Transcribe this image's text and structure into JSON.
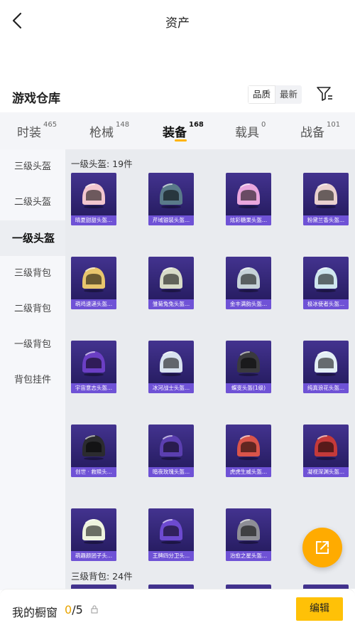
{
  "header": {
    "title": "资产"
  },
  "section": {
    "title": "游戏仓库",
    "sort_options": [
      "品质",
      "最新"
    ]
  },
  "tabs": [
    {
      "label": "时装",
      "count": "465"
    },
    {
      "label": "枪械",
      "count": "148"
    },
    {
      "label": "装备",
      "count": "168"
    },
    {
      "label": "载具",
      "count": "0"
    },
    {
      "label": "战备",
      "count": "101"
    }
  ],
  "active_tab": "装备",
  "sidebar": {
    "items": [
      "三级头盔",
      "二级头盔",
      "一级头盔",
      "三级背包",
      "二级背包",
      "一级背包",
      "背包挂件"
    ],
    "active": "一级头盔"
  },
  "groups": [
    {
      "label": "一级头盔: 19件"
    },
    {
      "label": "三级背包: 24件"
    }
  ],
  "items": [
    {
      "name": "晴夏甜甜头盔...",
      "color": "#f2c6cf"
    },
    {
      "name": "芹域银装头盔...",
      "color": "#5a7a8a"
    },
    {
      "name": "炫彩糖果头盔...",
      "color": "#e9a6dd"
    },
    {
      "name": "粉黛兰香头盔...",
      "color": "#e9d0cf"
    },
    {
      "name": "萌鸡速递头盔...",
      "color": "#e8c56d"
    },
    {
      "name": "雏菊兔兔头盔...",
      "color": "#d8dcc8"
    },
    {
      "name": "金丰满韵头盔...",
      "color": "#c6d2d8"
    },
    {
      "name": "极冰使者头盔...",
      "color": "#cfe6ef"
    },
    {
      "name": "宇宙意志头盔...",
      "color": "#6b3fc4"
    },
    {
      "name": "冰河战士头盔...",
      "color": "#d9e3ef"
    },
    {
      "name": "蝶变头盔(1级)",
      "color": "#3a3a3e"
    },
    {
      "name": "纯真浪花头盔...",
      "color": "#e3eef5"
    },
    {
      "name": "创世 · 救赎头...",
      "color": "#2b2b2f"
    },
    {
      "name": "暗夜玫瑰头盔...",
      "color": "#5b3fb0"
    },
    {
      "name": "虎虎生威头盔...",
      "color": "#d9544a"
    },
    {
      "name": "凝视深渊头盔...",
      "color": "#c43a3a"
    },
    {
      "name": "萌趣颜团子头...",
      "color": "#eef3de"
    },
    {
      "name": "王牌四分卫头...",
      "color": "#6d4ad0"
    },
    {
      "name": "治愈之星头盔...",
      "color": "#8e8e96"
    }
  ],
  "bottom": {
    "label": "我的橱窗",
    "current": "0",
    "total": "/5",
    "edit_label": "编辑"
  },
  "colors": {
    "accent": "#ffb300",
    "card_bg": "#2b2069",
    "card_label_bg": "#6f52d6"
  }
}
